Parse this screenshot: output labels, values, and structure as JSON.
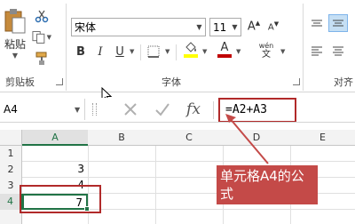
{
  "ribbon": {
    "paste_label": "粘贴",
    "clipboard_group": "剪贴板",
    "font_group": "字体",
    "align_group": "对齐",
    "font_name": "宋体",
    "font_size": "11",
    "bold": "B",
    "italic": "I",
    "underline": "U",
    "font_color_letter": "A",
    "phonetic_label": "wén",
    "accent_red": "#c00000",
    "highlight_yellow": "#ffff00"
  },
  "formula_bar": {
    "name_box": "A4",
    "formula": "=A2+A3",
    "fx_label": "fx"
  },
  "sheet": {
    "columns": [
      "A",
      "B",
      "C",
      "D",
      "E"
    ],
    "rows": [
      {
        "num": "1",
        "a": ""
      },
      {
        "num": "2",
        "a": "3"
      },
      {
        "num": "3",
        "a": "4"
      },
      {
        "num": "4",
        "a": "7"
      }
    ]
  },
  "annotation": {
    "callout_line1": "单元格A4的公",
    "callout_line2": "式"
  }
}
